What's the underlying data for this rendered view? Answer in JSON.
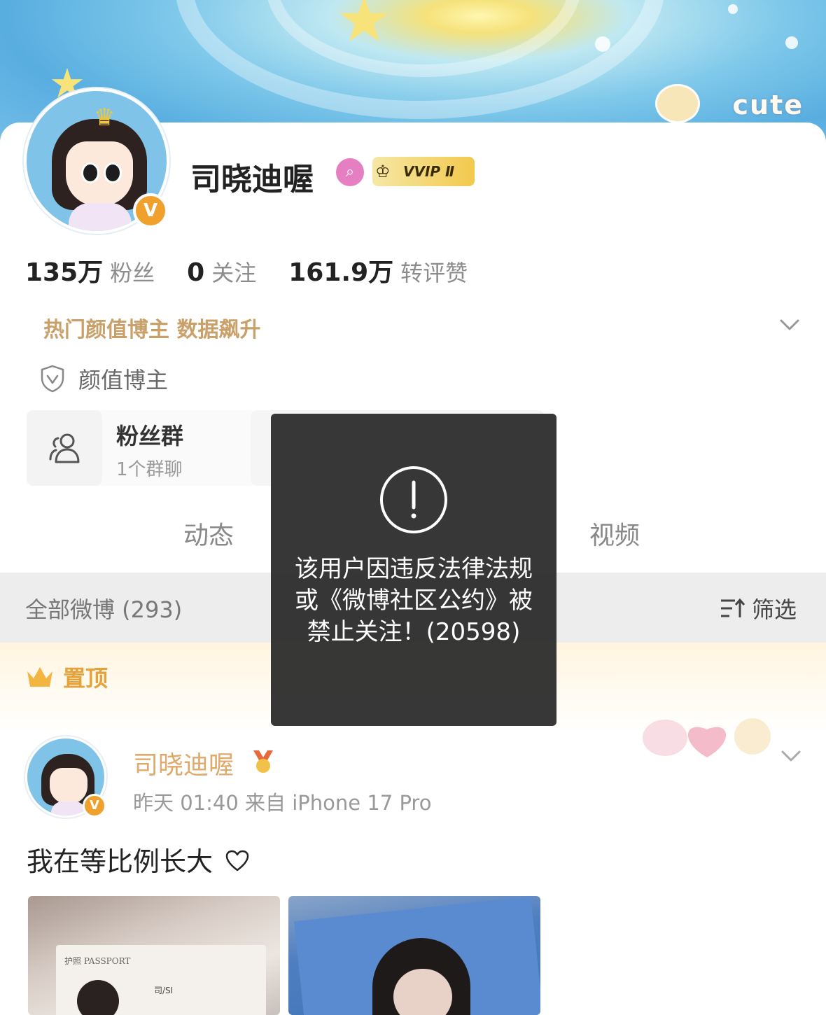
{
  "banner": {
    "deco_text": "cute"
  },
  "profile": {
    "nickname": "司晓迪喔",
    "vip_label": "VVIP Ⅱ",
    "verified_mark": "V"
  },
  "stats": [
    {
      "value": "135万",
      "label": "粉丝"
    },
    {
      "value": "0",
      "label": "关注"
    },
    {
      "value": "161.9万",
      "label": "转评赞"
    }
  ],
  "hot_tag": "热门颜值博主 数据飙升",
  "badge_label": "颜值博主",
  "fans_group": {
    "title": "粉丝群",
    "subtitle": "1个群聊"
  },
  "tabs": [
    {
      "label": "动态"
    },
    {
      "label": "视频"
    }
  ],
  "feed": {
    "all_label": "全部微博 (293)",
    "filter_label": "筛选",
    "pinned_label": "置顶"
  },
  "post": {
    "author": "司晓迪喔",
    "meta": "昨天 01:40  来自 iPhone 17 Pro",
    "text": "我在等比例长大",
    "photo1_label": "护照 PASSPORT",
    "photo1_name": "司/SI"
  },
  "toast": {
    "message": "该用户因违反法律法规或《微博社区公约》被禁止关注！(20598)",
    "icon": "exclamation-circle-icon"
  },
  "colors": {
    "orange_accent": "#e5a23a",
    "tag_gold": "#c9a06a",
    "toast_bg": "#282828"
  }
}
